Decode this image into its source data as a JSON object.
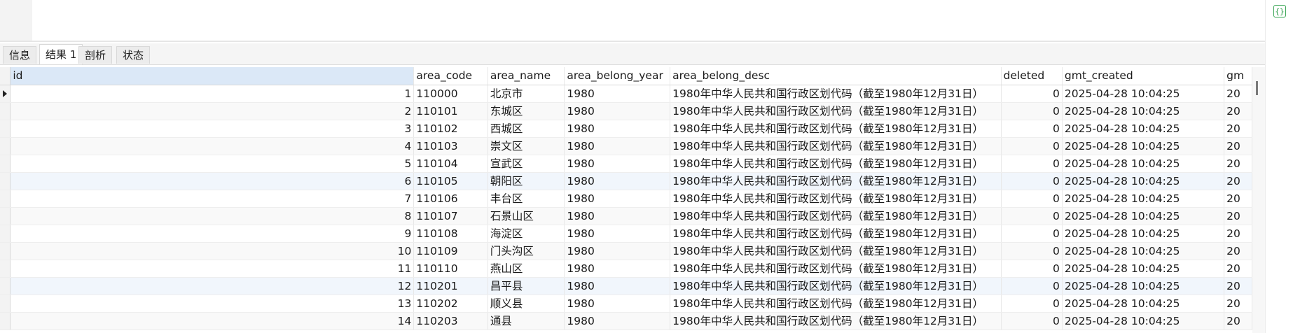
{
  "tabs": [
    {
      "label": "信息",
      "active": false
    },
    {
      "label": "结果 1",
      "active": true
    },
    {
      "label": "剖析",
      "active": false
    },
    {
      "label": "状态",
      "active": false
    }
  ],
  "icons": {
    "right_panel": "code-braces-icon"
  },
  "colors": {
    "selected_header": "#dbe8f7",
    "icon_green": "#2e9d4a"
  },
  "columns": [
    "id",
    "area_code",
    "area_name",
    "area_belong_year",
    "area_belong_desc",
    "deleted",
    "gmt_created",
    "gm"
  ],
  "rows": [
    {
      "id": "1",
      "area_code": "110000",
      "area_name": "北京市",
      "area_belong_year": "1980",
      "area_belong_desc": "1980年中华人民共和国行政区划代码（截至1980年12月31日）",
      "deleted": "0",
      "gmt_created": "2025-04-28 10:04:25",
      "gm": "20"
    },
    {
      "id": "2",
      "area_code": "110101",
      "area_name": "东城区",
      "area_belong_year": "1980",
      "area_belong_desc": "1980年中华人民共和国行政区划代码（截至1980年12月31日）",
      "deleted": "0",
      "gmt_created": "2025-04-28 10:04:25",
      "gm": "20"
    },
    {
      "id": "3",
      "area_code": "110102",
      "area_name": "西城区",
      "area_belong_year": "1980",
      "area_belong_desc": "1980年中华人民共和国行政区划代码（截至1980年12月31日）",
      "deleted": "0",
      "gmt_created": "2025-04-28 10:04:25",
      "gm": "20"
    },
    {
      "id": "4",
      "area_code": "110103",
      "area_name": "崇文区",
      "area_belong_year": "1980",
      "area_belong_desc": "1980年中华人民共和国行政区划代码（截至1980年12月31日）",
      "deleted": "0",
      "gmt_created": "2025-04-28 10:04:25",
      "gm": "20"
    },
    {
      "id": "5",
      "area_code": "110104",
      "area_name": "宣武区",
      "area_belong_year": "1980",
      "area_belong_desc": "1980年中华人民共和国行政区划代码（截至1980年12月31日）",
      "deleted": "0",
      "gmt_created": "2025-04-28 10:04:25",
      "gm": "20"
    },
    {
      "id": "6",
      "area_code": "110105",
      "area_name": "朝阳区",
      "area_belong_year": "1980",
      "area_belong_desc": "1980年中华人民共和国行政区划代码（截至1980年12月31日）",
      "deleted": "0",
      "gmt_created": "2025-04-28 10:04:25",
      "gm": "20"
    },
    {
      "id": "7",
      "area_code": "110106",
      "area_name": "丰台区",
      "area_belong_year": "1980",
      "area_belong_desc": "1980年中华人民共和国行政区划代码（截至1980年12月31日）",
      "deleted": "0",
      "gmt_created": "2025-04-28 10:04:25",
      "gm": "20"
    },
    {
      "id": "8",
      "area_code": "110107",
      "area_name": "石景山区",
      "area_belong_year": "1980",
      "area_belong_desc": "1980年中华人民共和国行政区划代码（截至1980年12月31日）",
      "deleted": "0",
      "gmt_created": "2025-04-28 10:04:25",
      "gm": "20"
    },
    {
      "id": "9",
      "area_code": "110108",
      "area_name": "海淀区",
      "area_belong_year": "1980",
      "area_belong_desc": "1980年中华人民共和国行政区划代码（截至1980年12月31日）",
      "deleted": "0",
      "gmt_created": "2025-04-28 10:04:25",
      "gm": "20"
    },
    {
      "id": "10",
      "area_code": "110109",
      "area_name": "门头沟区",
      "area_belong_year": "1980",
      "area_belong_desc": "1980年中华人民共和国行政区划代码（截至1980年12月31日）",
      "deleted": "0",
      "gmt_created": "2025-04-28 10:04:25",
      "gm": "20"
    },
    {
      "id": "11",
      "area_code": "110110",
      "area_name": "燕山区",
      "area_belong_year": "1980",
      "area_belong_desc": "1980年中华人民共和国行政区划代码（截至1980年12月31日）",
      "deleted": "0",
      "gmt_created": "2025-04-28 10:04:25",
      "gm": "20"
    },
    {
      "id": "12",
      "area_code": "110201",
      "area_name": "昌平县",
      "area_belong_year": "1980",
      "area_belong_desc": "1980年中华人民共和国行政区划代码（截至1980年12月31日）",
      "deleted": "0",
      "gmt_created": "2025-04-28 10:04:25",
      "gm": "20"
    },
    {
      "id": "13",
      "area_code": "110202",
      "area_name": "顺义县",
      "area_belong_year": "1980",
      "area_belong_desc": "1980年中华人民共和国行政区划代码（截至1980年12月31日）",
      "deleted": "0",
      "gmt_created": "2025-04-28 10:04:25",
      "gm": "20"
    },
    {
      "id": "14",
      "area_code": "110203",
      "area_name": "通县",
      "area_belong_year": "1980",
      "area_belong_desc": "1980年中华人民共和国行政区划代码（截至1980年12月31日）",
      "deleted": "0",
      "gmt_created": "2025-04-28 10:04:25",
      "gm": "20"
    }
  ]
}
